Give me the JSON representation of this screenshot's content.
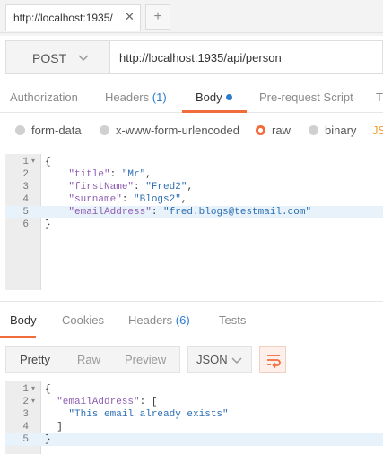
{
  "tabs": [
    {
      "title": "http://localhost:1935/",
      "close": "✕"
    }
  ],
  "new_tab": "+",
  "request": {
    "method": "POST",
    "url": "http://localhost:1935/api/person"
  },
  "request_tabs": {
    "authorization": "Authorization",
    "headers": "Headers",
    "headers_count": "(1)",
    "body": "Body",
    "pre_request": "Pre-request Script",
    "tests_partial": "T"
  },
  "body_types": {
    "form_data": "form-data",
    "urlencoded": "x-www-form-urlencoded",
    "raw": "raw",
    "binary": "binary",
    "selected": "raw",
    "language_partial": "JS"
  },
  "request_body": {
    "lines": [
      {
        "num": "1",
        "fold": true,
        "parts": [
          [
            "p",
            "{"
          ]
        ]
      },
      {
        "num": "2",
        "fold": false,
        "parts": [
          [
            "p",
            "    "
          ],
          [
            "k",
            "\"title\""
          ],
          [
            "p",
            ": "
          ],
          [
            "s",
            "\"Mr\""
          ],
          [
            "p",
            ","
          ]
        ]
      },
      {
        "num": "3",
        "fold": false,
        "parts": [
          [
            "p",
            "    "
          ],
          [
            "k",
            "\"firstName\""
          ],
          [
            "p",
            ": "
          ],
          [
            "s",
            "\"Fred2\""
          ],
          [
            "p",
            ","
          ]
        ]
      },
      {
        "num": "4",
        "fold": false,
        "parts": [
          [
            "p",
            "    "
          ],
          [
            "k",
            "\"surname\""
          ],
          [
            "p",
            ": "
          ],
          [
            "s",
            "\"Blogs2\""
          ],
          [
            "p",
            ","
          ]
        ]
      },
      {
        "num": "5",
        "fold": false,
        "highlight": true,
        "parts": [
          [
            "p",
            "    "
          ],
          [
            "k",
            "\"emailAddress\""
          ],
          [
            "p",
            ": "
          ],
          [
            "s",
            "\"fred.blogs@testmail.com\""
          ]
        ]
      },
      {
        "num": "6",
        "fold": false,
        "parts": [
          [
            "p",
            "}"
          ]
        ]
      }
    ]
  },
  "response_tabs": {
    "body": "Body",
    "cookies": "Cookies",
    "headers": "Headers",
    "headers_count": "(6)",
    "tests": "Tests"
  },
  "view_modes": {
    "pretty": "Pretty",
    "raw": "Raw",
    "preview": "Preview",
    "format": "JSON"
  },
  "response_body": {
    "lines": [
      {
        "num": "1",
        "fold": true,
        "parts": [
          [
            "p",
            "{"
          ]
        ]
      },
      {
        "num": "2",
        "fold": true,
        "parts": [
          [
            "p",
            "  "
          ],
          [
            "k",
            "\"emailAddress\""
          ],
          [
            "p",
            ": ["
          ]
        ]
      },
      {
        "num": "3",
        "fold": false,
        "parts": [
          [
            "p",
            "    "
          ],
          [
            "s",
            "\"This email already exists\""
          ]
        ]
      },
      {
        "num": "4",
        "fold": false,
        "parts": [
          [
            "p",
            "  ]"
          ]
        ]
      },
      {
        "num": "5",
        "fold": false,
        "highlight": true,
        "parts": [
          [
            "p",
            "}"
          ]
        ]
      }
    ]
  },
  "icons": {
    "method_dropdown": "chevron-down-icon",
    "format_dropdown": "chevron-down-icon",
    "wrap": "wrap-lines-icon",
    "fold": "fold-arrow-icon"
  },
  "colors": {
    "accent": "#f26b3a",
    "count": "#2b7bd1",
    "json_key": "#8e5db1",
    "json_string": "#2d6fb3",
    "line_highlight": "#e8f2fb"
  }
}
